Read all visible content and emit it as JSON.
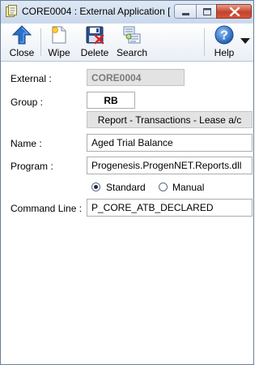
{
  "window": {
    "title": "CORE0004 : External Application [...",
    "buttons": {
      "minimize": "minimize",
      "maximize": "maximize",
      "close": "close"
    }
  },
  "toolbar": {
    "close_label": "Close",
    "wipe_label": "Wipe",
    "delete_label": "Delete",
    "search_label": "Search",
    "help_label": "Help"
  },
  "form": {
    "external": {
      "label": "External :",
      "value": "CORE0004"
    },
    "group": {
      "label": "Group :",
      "value": "RB",
      "description": "Report - Transactions - Lease a/c"
    },
    "name": {
      "label": "Name :",
      "value": "Aged Trial Balance"
    },
    "program": {
      "label": "Program :",
      "value": "Progenesis.ProgenNET.Reports.dll"
    },
    "mode": {
      "options": [
        "Standard",
        "Manual"
      ],
      "selected": "Standard"
    },
    "command_line": {
      "label": "Command Line :",
      "value": "P_CORE_ATB_DECLARED"
    }
  },
  "icons": {
    "app": "app-form-icon",
    "close": "up-arrow-icon",
    "wipe": "blank-page-icon",
    "delete": "floppy-delete-icon",
    "search": "search-list-icon",
    "help": "help-icon"
  },
  "colors": {
    "accent": "#2a6fc9",
    "close_button": "#c4432b"
  }
}
